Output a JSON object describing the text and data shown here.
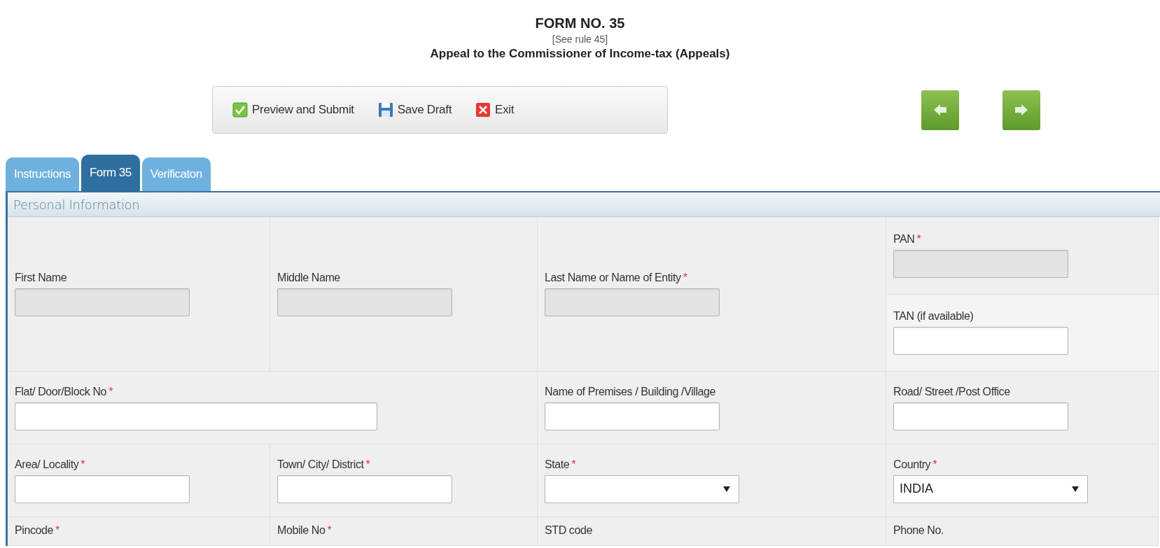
{
  "header": {
    "title": "FORM NO. 35",
    "rule": "[See rule 45]",
    "heading": "Appeal to the Commissioner of Income-tax (Appeals)"
  },
  "toolbar": [
    {
      "label": "Preview and Submit"
    },
    {
      "label": "Save Draft"
    },
    {
      "label": "Exit"
    }
  ],
  "tabs": [
    {
      "label": "Instructions",
      "selected": false
    },
    {
      "label": "Form 35",
      "selected": true
    },
    {
      "label": "Verificaton",
      "selected": false
    }
  ],
  "section": {
    "title": "Personal Information"
  },
  "rows": [
    {
      "cells": [
        {
          "fields": [
            {
              "label": "First Name",
              "kind": "text",
              "disabled": true
            }
          ]
        },
        {
          "fields": [
            {
              "label": "Middle Name",
              "kind": "text",
              "disabled": true
            }
          ]
        },
        {
          "fields": [
            {
              "label": "Last Name or Name of Entity",
              "mark": "*",
              "kind": "text",
              "disabled": true
            }
          ]
        },
        {
          "fields": [
            {
              "label": "PAN",
              "mark": "*",
              "kind": "text",
              "disabled": true
            },
            {
              "label": "TAN (if available)",
              "kind": "text",
              "disabled": false
            }
          ]
        }
      ]
    },
    {
      "cells": [
        {
          "fields": [
            {
              "label": "Flat/ Door/Block No",
              "mark": "*",
              "kind": "wide",
              "disabled": false
            }
          ]
        },
        {
          "fields": [
            {
              "label": "Name of Premises / Building /Village",
              "kind": "text",
              "disabled": false
            }
          ]
        },
        {
          "fields": [
            {
              "label": "Road/ Street /Post Office",
              "kind": "text",
              "disabled": false
            }
          ]
        }
      ]
    },
    {
      "cells": [
        {
          "fields": [
            {
              "label": "Area/ Locality",
              "mark": "*",
              "kind": "text",
              "disabled": false
            }
          ]
        },
        {
          "fields": [
            {
              "label": "Town/ City/ District",
              "mark": "*",
              "kind": "text",
              "disabled": false
            }
          ]
        },
        {
          "fields": [
            {
              "label": "State",
              "mark": "*",
              "kind": "select",
              "disabled": false
            }
          ]
        },
        {
          "fields": [
            {
              "label": "Country",
              "mark": "*",
              "kind": "select",
              "value": "INDIA",
              "disabled": false
            }
          ]
        }
      ]
    },
    {
      "cells": [
        {
          "fields": [
            {
              "label": "Pincode",
              "mark": "*",
              "kind": "label"
            }
          ]
        },
        {
          "fields": [
            {
              "label": "Mobile No",
              "mark": "*",
              "kind": "label"
            }
          ]
        },
        {
          "fields": [
            {
              "label": "STD code",
              "kind": "label"
            }
          ]
        },
        {
          "fields": [
            {
              "label": "Phone No.",
              "kind": "label"
            }
          ]
        }
      ]
    }
  ]
}
